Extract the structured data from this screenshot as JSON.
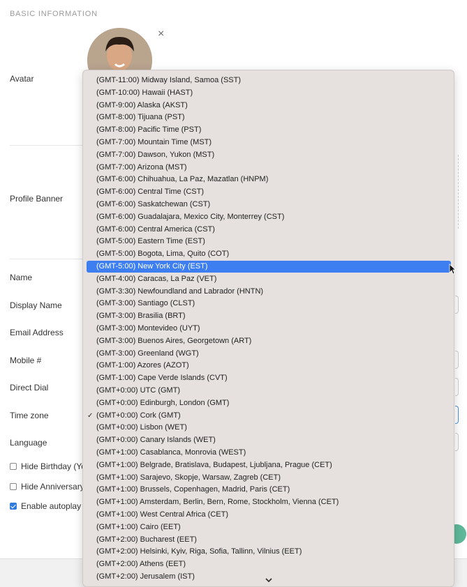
{
  "section": {
    "title": "BASIC INFORMATION"
  },
  "labels": {
    "avatar": "Avatar",
    "profile_banner": "Profile Banner",
    "name": "Name",
    "display_name": "Display Name",
    "email": "Email Address",
    "mobile": "Mobile #",
    "direct_dial": "Direct Dial",
    "time_zone": "Time zone",
    "language": "Language"
  },
  "checkboxes": {
    "hide_birthday": "Hide Birthday (Yo",
    "hide_anniversary": "Hide Anniversary",
    "enable_autoplay": "Enable autoplay v"
  },
  "icons": {
    "close": "×",
    "check": "✓"
  },
  "timezones": [
    "(GMT-11:00) Midway Island, Samoa (SST)",
    "(GMT-10:00) Hawaii (HAST)",
    "(GMT-9:00) Alaska (AKST)",
    "(GMT-8:00) Tijuana (PST)",
    "(GMT-8:00) Pacific Time (PST)",
    "(GMT-7:00) Mountain Time (MST)",
    "(GMT-7:00) Dawson, Yukon (MST)",
    "(GMT-7:00) Arizona (MST)",
    "(GMT-6:00) Chihuahua, La Paz, Mazatlan (HNPM)",
    "(GMT-6:00) Central Time (CST)",
    "(GMT-6:00) Saskatchewan (CST)",
    "(GMT-6:00) Guadalajara, Mexico City, Monterrey (CST)",
    "(GMT-6:00) Central America (CST)",
    "(GMT-5:00) Eastern Time (EST)",
    "(GMT-5:00) Bogota, Lima, Quito (COT)",
    "(GMT-5:00) New York City (EST)",
    "(GMT-4:00) Caracas, La Paz (VET)",
    "(GMT-3:30) Newfoundland and Labrador (HNTN)",
    "(GMT-3:00) Santiago (CLST)",
    "(GMT-3:00) Brasilia (BRT)",
    "(GMT-3:00) Montevideo (UYT)",
    "(GMT-3:00) Buenos Aires, Georgetown (ART)",
    "(GMT-3:00) Greenland (WGT)",
    "(GMT-1:00) Azores (AZOT)",
    "(GMT-1:00) Cape Verde Islands (CVT)",
    "(GMT+0:00) UTC (GMT)",
    "(GMT+0:00) Edinburgh, London (GMT)",
    "(GMT+0:00) Cork (GMT)",
    "(GMT+0:00) Lisbon (WET)",
    "(GMT+0:00) Canary Islands (WET)",
    "(GMT+1:00) Casablanca, Monrovia (WEST)",
    "(GMT+1:00) Belgrade, Bratislava, Budapest, Ljubljana, Prague (CET)",
    "(GMT+1:00) Sarajevo, Skopje, Warsaw, Zagreb (CET)",
    "(GMT+1:00) Brussels, Copenhagen, Madrid, Paris (CET)",
    "(GMT+1:00) Amsterdam, Berlin, Bern, Rome, Stockholm, Vienna (CET)",
    "(GMT+1:00) West Central Africa (CET)",
    "(GMT+1:00) Cairo (EET)",
    "(GMT+2:00) Bucharest (EET)",
    "(GMT+2:00) Helsinki, Kyiv, Riga, Sofia, Tallinn, Vilnius (EET)",
    "(GMT+2:00) Athens (EET)",
    "(GMT+2:00) Jerusalem (IST)"
  ],
  "highlighted_timezone": "(GMT-5:00) New York City (EST)",
  "selected_timezone": "(GMT+0:00) Cork (GMT)",
  "colors": {
    "highlight": "#3d7ff0",
    "menu_bg": "#e6e1de",
    "accent_green": "#5fb89a"
  }
}
